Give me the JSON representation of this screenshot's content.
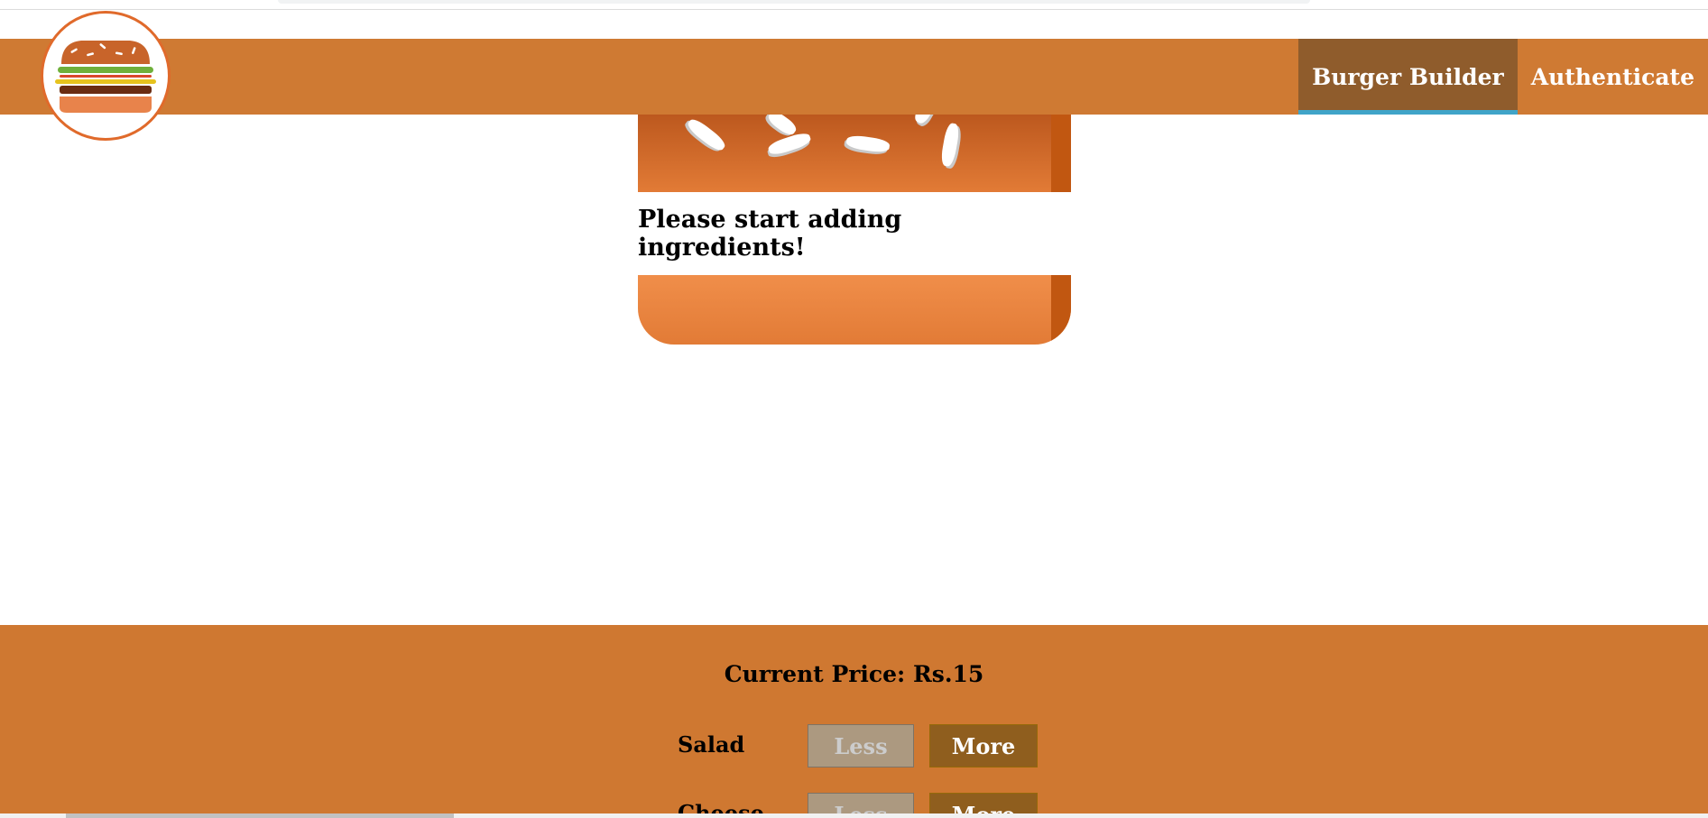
{
  "header": {
    "logo_icon": "burger-logo-icon",
    "nav": [
      {
        "label": "Burger Builder",
        "active": true
      },
      {
        "label": "Authenticate",
        "active": false
      }
    ]
  },
  "burger": {
    "message": "Please start adding ingredients!"
  },
  "controls": {
    "price_label": "Current Price: Rs.15",
    "rows": [
      {
        "label": "Salad",
        "less": "Less",
        "more": "More"
      },
      {
        "label": "Cheese",
        "less": "Less",
        "more": "More"
      }
    ]
  },
  "colors": {
    "toolbar": "#cf7a33",
    "active_nav": "#8f5c2c",
    "active_underline": "#40a4c8",
    "controls_bg": "#cf7831",
    "more_button": "#8f5e1e",
    "less_button_disabled": "#ac9980"
  }
}
